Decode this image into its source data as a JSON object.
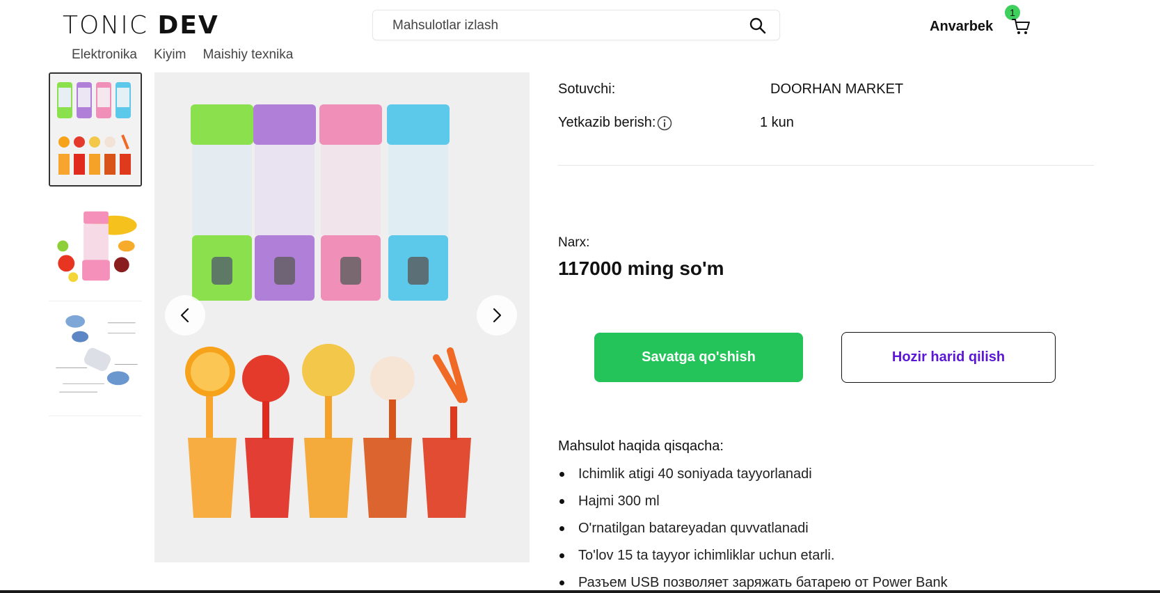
{
  "header": {
    "logo_light": "TONIC ",
    "logo_bold": "DEV",
    "search_placeholder": "Mahsulotlar izlash",
    "username": "Anvarbek",
    "cart_count": "1"
  },
  "nav": {
    "items": [
      "Elektronika",
      "Kiyim",
      "Maishiy texnika"
    ]
  },
  "product": {
    "seller_label": "Sotuvchi:",
    "seller_value": "DOORHAN MARKET",
    "delivery_label": "Yetkazib berish:",
    "delivery_value": "1 kun",
    "price_label": "Narx:",
    "price_value": "117000 ming so'm",
    "add_to_cart_label": "Savatga qo'shish",
    "buy_now_label": "Hozir harid qilish",
    "description_title": "Mahsulot haqida qisqacha:",
    "features": [
      "Ichimlik atigi 40 soniyada tayyorlanadi",
      "Hajmi 300 ml",
      "O'rnatilgan batareyadan quvvatlanadi",
      "To'lov 15 ta tayyor ichimliklar uchun etarli.",
      "Разъем USB позволяет заряжать батарею от Power Bank"
    ]
  },
  "gallery": {
    "thumbnails": [
      "blenders-and-juices",
      "pink-blender-with-fruits",
      "blender-parts-diagram"
    ],
    "active_index": 0
  },
  "colors": {
    "accent_green": "#24c45a",
    "badge_green": "#3ecf5c",
    "buy_text_purple": "#5b16d6"
  }
}
